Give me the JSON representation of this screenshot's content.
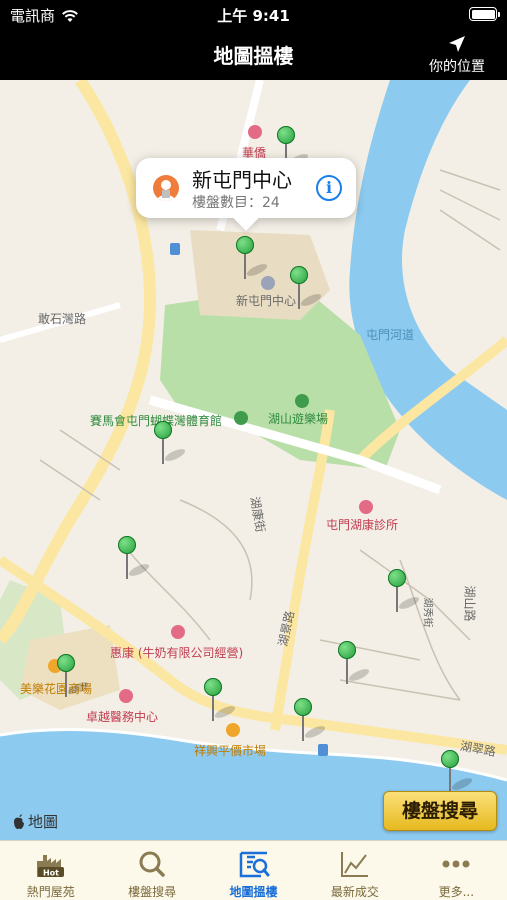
{
  "status_bar": {
    "carrier": "電訊商",
    "time": "上午 9:41"
  },
  "nav": {
    "title": "地圖搵樓",
    "location_button": "你的位置"
  },
  "callout": {
    "title": "新屯門中心",
    "subtitle": "樓盤數目：24"
  },
  "map_labels": {
    "poi_top": "華僑",
    "street_left": "敢石灣路",
    "center": "新屯門中心",
    "river": "屯門河道",
    "park": "湖山遊樂場",
    "sports": "賽馬會屯門蝴蝶灣體育館",
    "clinic": "屯門湖康診所",
    "street_mid": "湖康街",
    "street_right": "湖山路",
    "street_right2": "湖秀街",
    "street_diag": "湖景路",
    "shop": "惠康 (牛奶有限公司經營)",
    "mall": "美樂花園商場",
    "medical": "卓越醫務中心",
    "market": "祥興平價市場",
    "road_bottom": "湖翠路"
  },
  "map_attribution": "地圖",
  "search_button": "樓盤搜尋",
  "tabs": [
    {
      "label": "熱門屋苑",
      "icon": "hot-estates-icon"
    },
    {
      "label": "樓盤搜尋",
      "icon": "search-icon"
    },
    {
      "label": "地圖搵樓",
      "icon": "map-search-icon",
      "active": true
    },
    {
      "label": "最新成交",
      "icon": "chart-icon"
    },
    {
      "label": "更多...",
      "icon": "more-icon"
    }
  ],
  "colors": {
    "active_tab": "#1a6fd8",
    "pin": "#1f9a35",
    "water": "#8ccaf0",
    "park": "#b9dfa9",
    "button": "#f2cc4a"
  }
}
